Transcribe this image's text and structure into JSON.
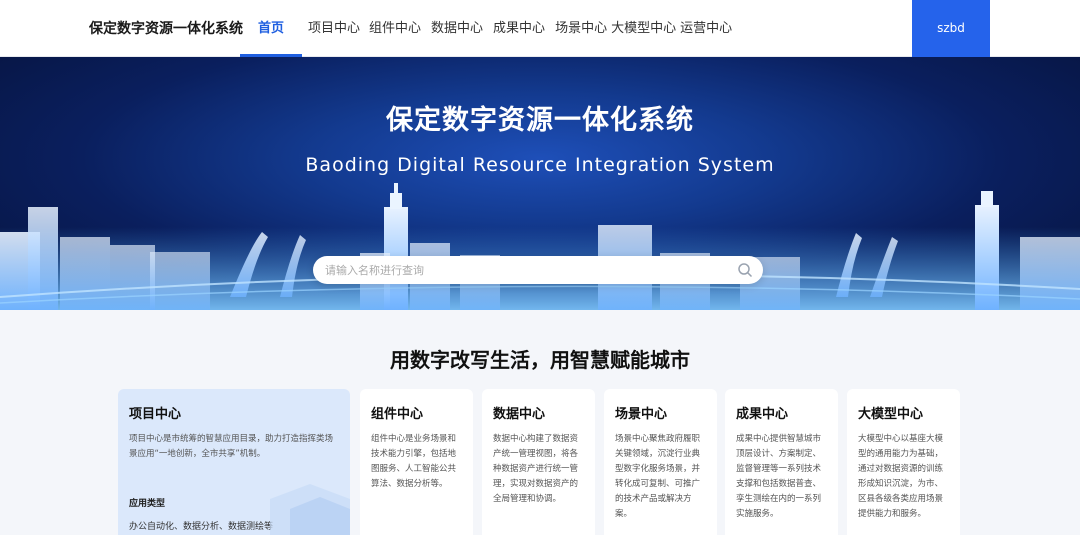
{
  "header": {
    "brand": "保定数字资源一体化系统",
    "nav": [
      "首页",
      "项目中心",
      "组件中心",
      "数据中心",
      "成果中心",
      "场景中心",
      "大模型中心",
      "运营中心"
    ],
    "active_nav": "首页",
    "user": "szbd"
  },
  "banner": {
    "title": "保定数字资源一体化系统",
    "subtitle": "Baoding Digital Resource Integration System",
    "search_placeholder": "请输入名称进行查询"
  },
  "section": {
    "title": "用数字改写生活，用智慧赋能城市"
  },
  "cards": [
    {
      "title": "项目中心",
      "desc": "项目中心是市统筹的智慧应用目录，助力打造指挥类场景应用“一地创新，全市共享”机制。",
      "sub_label": "应用类型",
      "tags": "办公自动化、数据分析、数据测绘等"
    },
    {
      "title": "组件中心",
      "desc": "组件中心是业务场景和技术能力引擎，包括地图服务、人工智能公共算法、数据分析等。"
    },
    {
      "title": "数据中心",
      "desc": "数据中心构建了数据资产统一管理视图，将各种数据资产进行统一管理，实现对数据资产的全局管理和协调。"
    },
    {
      "title": "场景中心",
      "desc": "场景中心聚焦政府履职关键领域，沉淀行业典型数字化服务场景，并转化成可复制、可推广的技术产品或解决方案。"
    },
    {
      "title": "成果中心",
      "desc": "成果中心提供智慧城市顶层设计、方案制定、监督管理等一系列技术支撑和包括数据普查、孪生测绘在内的一系列实施服务。"
    },
    {
      "title": "大模型中心",
      "desc": "大模型中心以基座大模型的通用能力为基础，通过对数据资源的训练形成知识沉淀，为市、区县各级各类应用场景提供能力和服务。"
    }
  ],
  "colors": {
    "accent": "#1f5fe0",
    "user_button": "#2563eb",
    "banner_dark": "#0a1f5e",
    "active_card": "#dbe8fb"
  }
}
